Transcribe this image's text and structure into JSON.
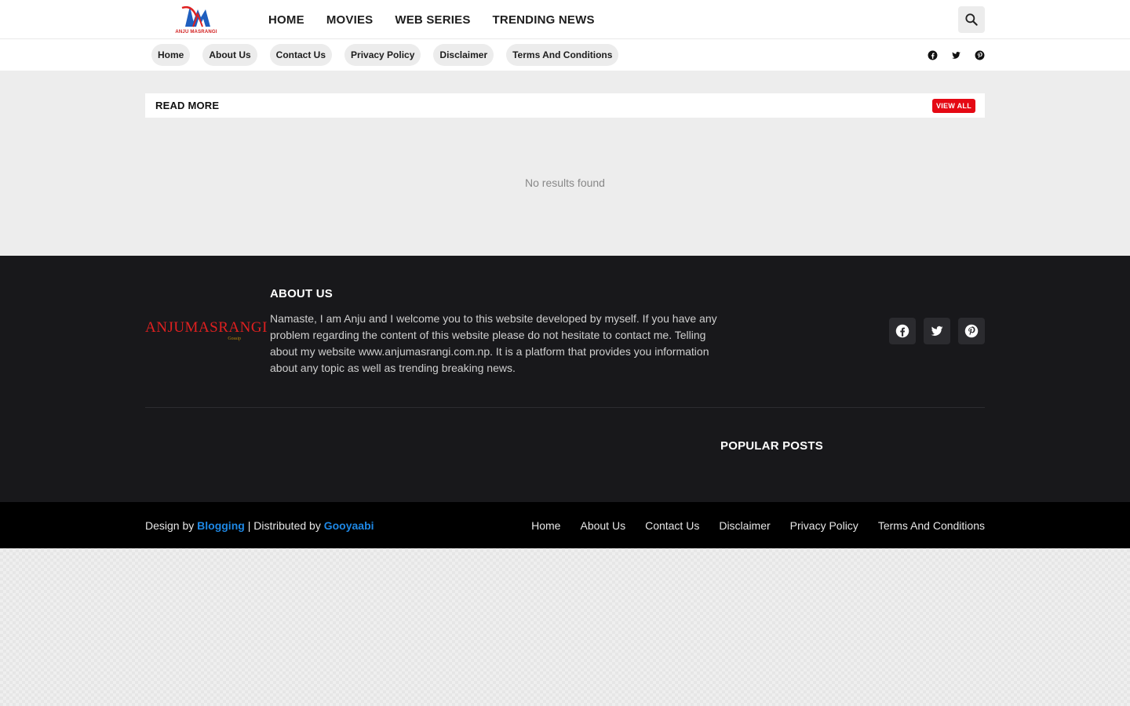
{
  "header": {
    "logo_text": "ANJU MASRANGI",
    "nav": [
      "HOME",
      "MOVIES",
      "WEB SERIES",
      "TRENDING NEWS"
    ],
    "search_icon": "search-icon"
  },
  "subnav": {
    "pills": [
      "Home",
      "About Us",
      "Contact Us",
      "Privacy Policy",
      "Disclaimer",
      "Terms And Conditions"
    ],
    "social": [
      "facebook-icon",
      "twitter-icon",
      "pinterest-icon"
    ]
  },
  "main": {
    "section_title": "READ MORE",
    "view_all": "VIEW ALL",
    "empty_message": "No results found"
  },
  "footer": {
    "logo_text": "ANJUMASRANGI",
    "logo_sub": "Gossip",
    "about_title": "ABOUT US",
    "about_text": "Namaste, I am Anju and I welcome you to this website developed by myself. If you have any problem regarding the content of this website please do not hesitate to contact me. Telling about my website www.anjumasrangi.com.np. It is a platform that provides you information about any topic as well as trending breaking news.",
    "popular_title": "POPULAR POSTS"
  },
  "bottom": {
    "design_by": "Design by",
    "design_link": "Blogging",
    "separator": "| Distributed by",
    "dist_link": "Gooyaabi",
    "nav": [
      "Home",
      "About Us",
      "Contact Us",
      "Disclaimer",
      "Privacy Policy",
      "Terms And Conditions"
    ]
  },
  "colors": {
    "accent": "#e50914",
    "footer_bg": "#18181b",
    "link_blue": "#1e88e5"
  }
}
